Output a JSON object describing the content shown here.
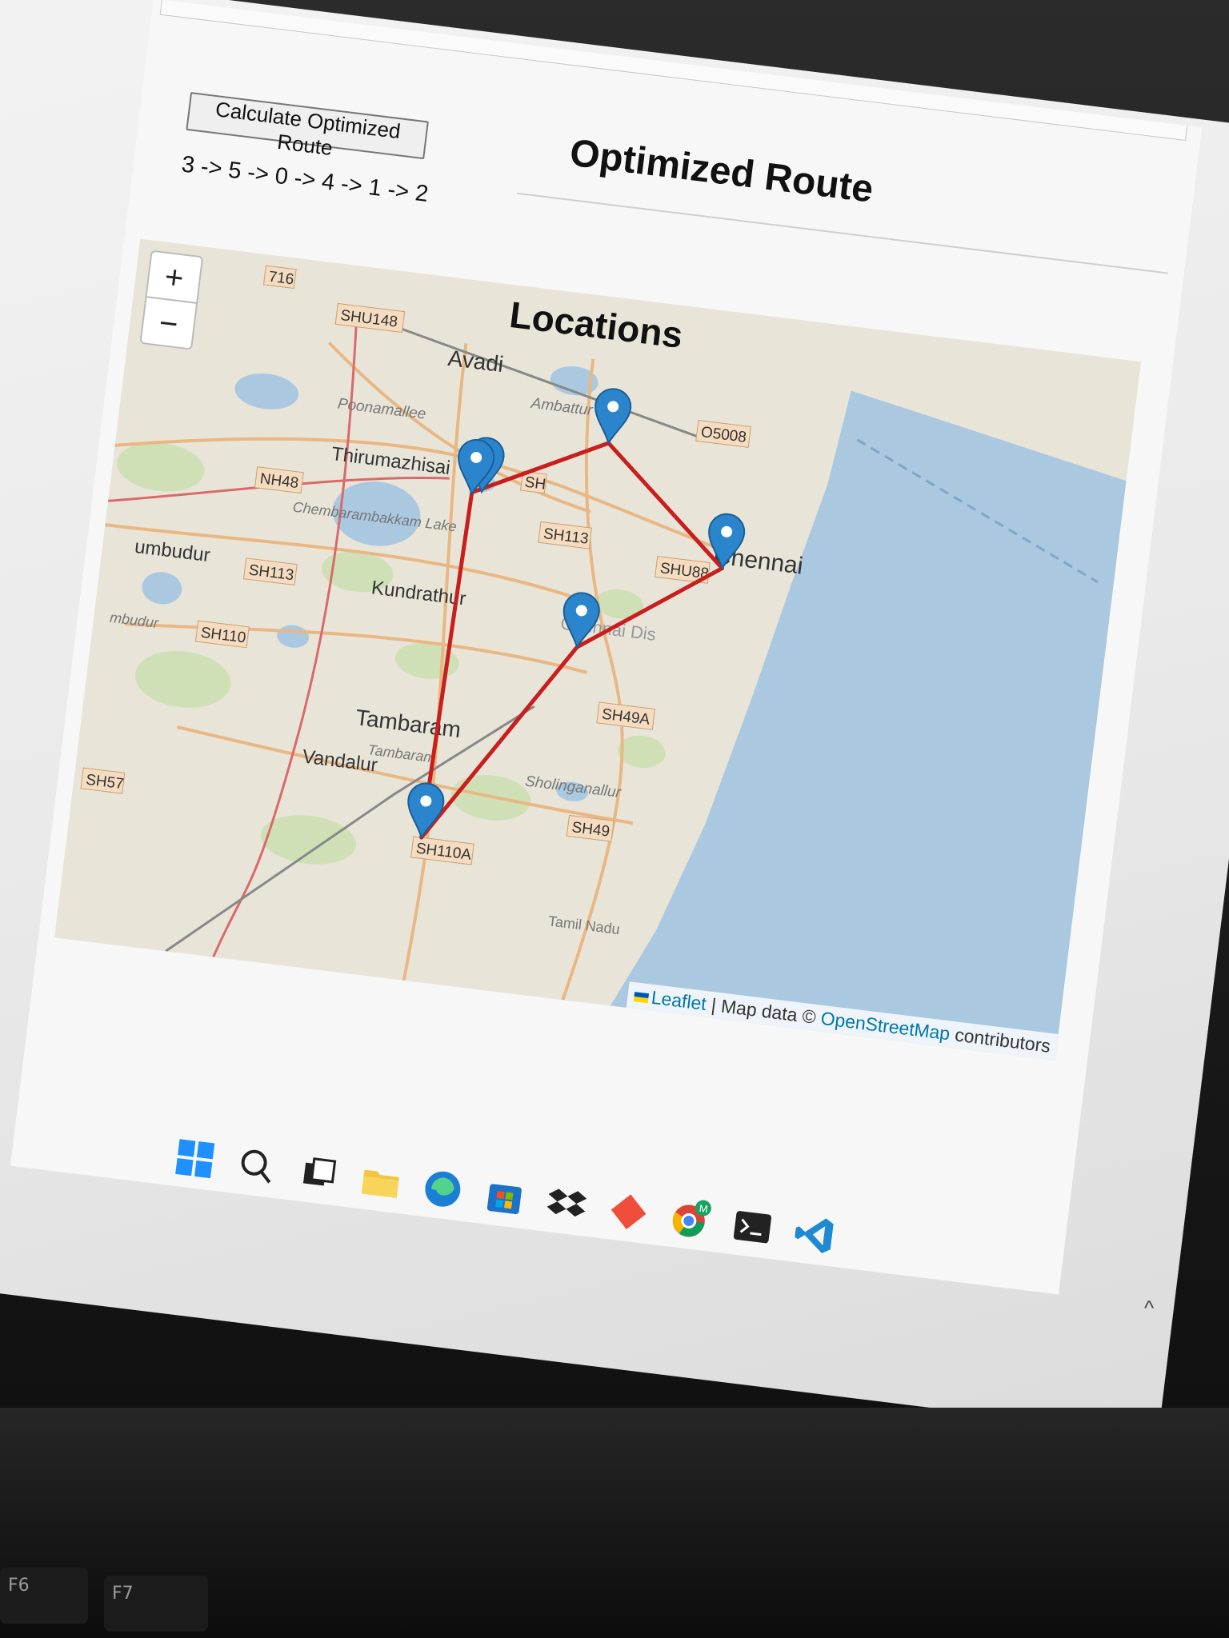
{
  "page": {
    "calc_button_label": "Calculate Optimized Route",
    "route_sequence": "3 -> 5 -> 0 -> 4 -> 1 -> 2",
    "title": "Optimized Route",
    "map_heading": "Locations"
  },
  "map": {
    "zoom_in": "+",
    "zoom_out": "−",
    "attribution": {
      "leaflet": "Leaflet",
      "separator": " | Map data © ",
      "osm": "OpenStreetMap",
      "suffix": " contributors"
    },
    "place_labels": [
      "Avadi",
      "Ambattur",
      "Chennai",
      "Poonamallee",
      "Thirumazhisai",
      "Chembarambakkam Lake",
      "Kundrathur",
      "umbudur",
      "mbudur",
      "Tambaram",
      "Tambaram",
      "Vandalur",
      "Sholinganallur",
      "Tamil Nadu",
      "Chennai Dis"
    ],
    "road_labels": [
      "716",
      "SHU148",
      "O5008",
      "NH48",
      "SH113",
      "SH113",
      "SHU88",
      "SH110",
      "SH49A",
      "SH49",
      "SH57",
      "SH110A",
      "SH"
    ],
    "marker_icon": "map-pin-icon",
    "route_color": "#c81e1e",
    "water_color": "#aac8e0"
  },
  "taskbar": {
    "icons": [
      "windows-start-icon",
      "search-icon",
      "task-view-icon",
      "file-explorer-icon",
      "edge-icon",
      "store-icon",
      "dropbox-icon",
      "app-diamond-icon",
      "chrome-icon",
      "terminal-icon",
      "vscode-icon"
    ],
    "chrome_badge": "M",
    "tray_chevron": "^"
  },
  "keyboard": {
    "f6": "F6",
    "f7": "F7"
  }
}
